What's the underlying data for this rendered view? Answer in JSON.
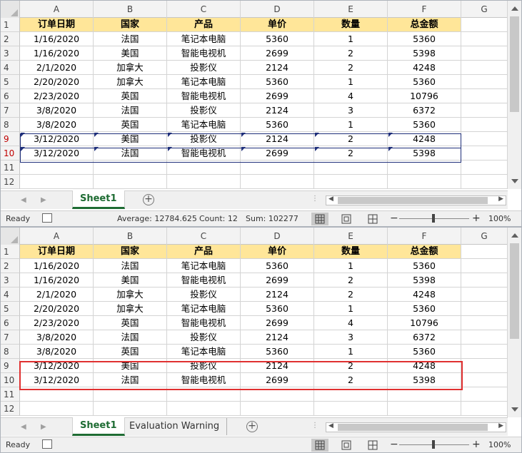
{
  "columns": [
    "A",
    "B",
    "C",
    "D",
    "E",
    "F",
    "G"
  ],
  "row_numbers": [
    "1",
    "2",
    "3",
    "4",
    "5",
    "6",
    "7",
    "8",
    "9",
    "10",
    "11",
    "12"
  ],
  "table": {
    "headers": [
      "订单日期",
      "国家",
      "产品",
      "单价",
      "数量",
      "总金额"
    ],
    "rows": [
      [
        "1/16/2020",
        "法国",
        "笔记本电脑",
        "5360",
        "1",
        "5360"
      ],
      [
        "1/16/2020",
        "美国",
        "智能电视机",
        "2699",
        "2",
        "5398"
      ],
      [
        "2/1/2020",
        "加拿大",
        "投影仪",
        "2124",
        "2",
        "4248"
      ],
      [
        "2/20/2020",
        "加拿大",
        "笔记本电脑",
        "5360",
        "1",
        "5360"
      ],
      [
        "2/23/2020",
        "英国",
        "智能电视机",
        "2699",
        "4",
        "10796"
      ],
      [
        "3/8/2020",
        "法国",
        "投影仪",
        "2124",
        "3",
        "6372"
      ],
      [
        "3/8/2020",
        "英国",
        "笔记本电脑",
        "5360",
        "1",
        "5360"
      ],
      [
        "3/12/2020",
        "美国",
        "投影仪",
        "2124",
        "2",
        "4248"
      ],
      [
        "3/12/2020",
        "法国",
        "智能电视机",
        "2699",
        "2",
        "5398"
      ]
    ]
  },
  "top": {
    "sheet_tab": "Sheet1",
    "status": {
      "ready": "Ready",
      "average": "Average: 12784.625",
      "count": "Count: 12",
      "sum": "Sum: 102277",
      "zoom": "100%"
    }
  },
  "bottom": {
    "sheet_tab": "Sheet1",
    "sheet_tab2": "Evaluation Warning",
    "status": {
      "ready": "Ready",
      "zoom": "100%"
    }
  },
  "icons": {
    "add_sheet": "+",
    "zoom_minus": "−",
    "zoom_plus": "+"
  }
}
